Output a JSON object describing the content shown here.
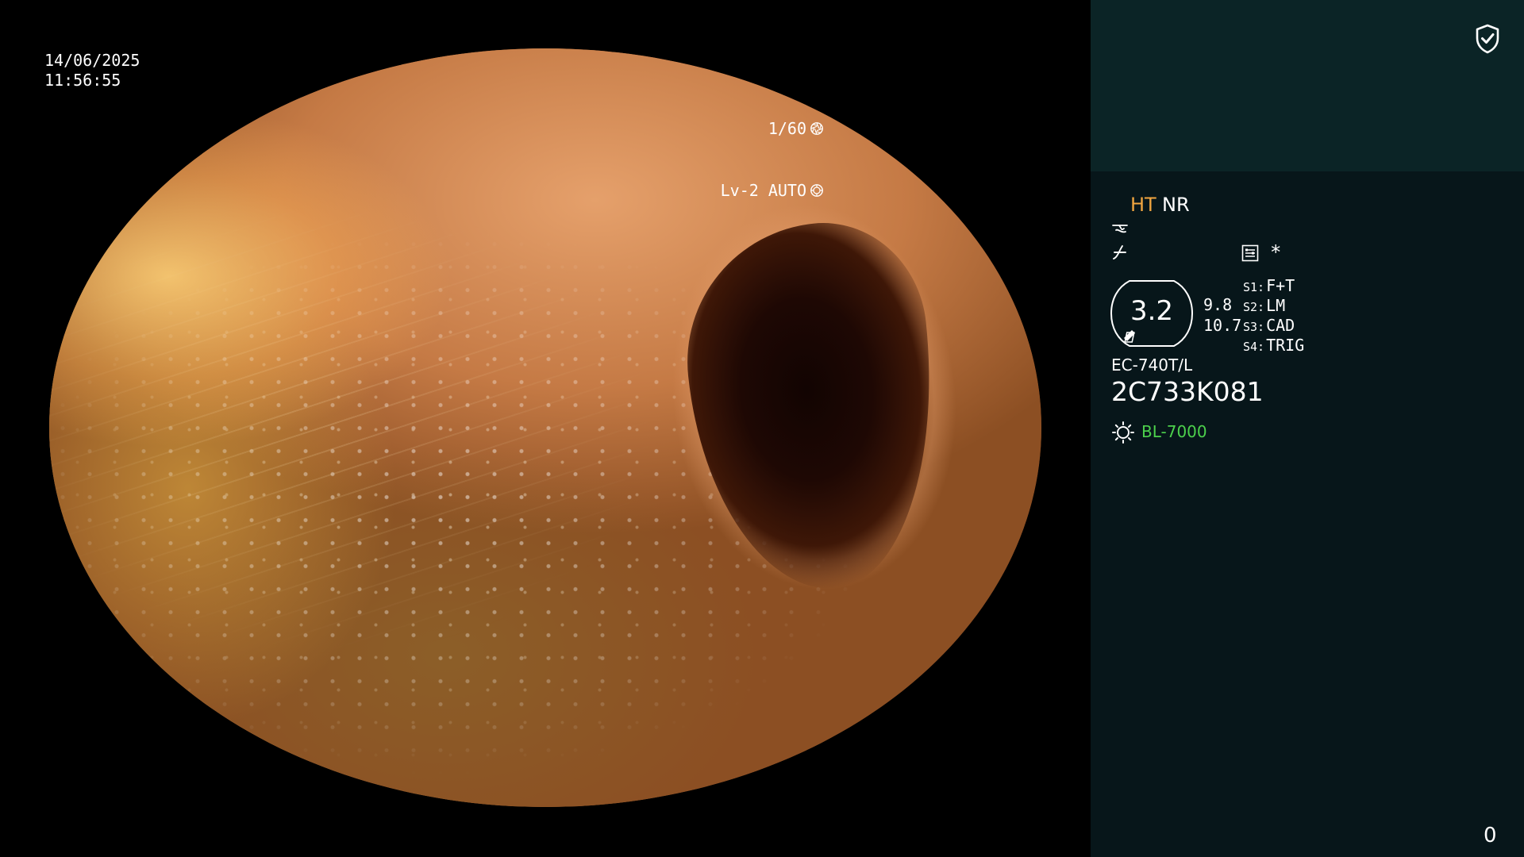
{
  "overlay": {
    "date": "14/06/2025",
    "time": "11:56:55",
    "shutter": "1/60",
    "iris": "Lv-2 AUTO"
  },
  "panel": {
    "mode_ht": "HT",
    "mode_nr": "NR",
    "star": "*",
    "zoom": {
      "value": "3.2",
      "a": "9.8",
      "b": "10.7"
    },
    "switches": [
      {
        "key": "S1:",
        "value": "F+T"
      },
      {
        "key": "S2:",
        "value": "LM"
      },
      {
        "key": "S3:",
        "value": "CAD"
      },
      {
        "key": "S4:",
        "value": "TRIG"
      }
    ],
    "scope_model": "EC-740T/L",
    "scope_serial": "2C733K081",
    "light_source": "BL-7000",
    "counter": "0"
  },
  "colors": {
    "ht_accent": "#f0a540",
    "light_source": "#4cd14c",
    "panel_top": "#0b2426",
    "panel_bottom": "#07161a"
  },
  "icons": [
    "shield-check-icon",
    "shutter-icon",
    "iris-icon",
    "wave-icon",
    "enhance-icon",
    "menu-icon",
    "lamp-icon"
  ]
}
